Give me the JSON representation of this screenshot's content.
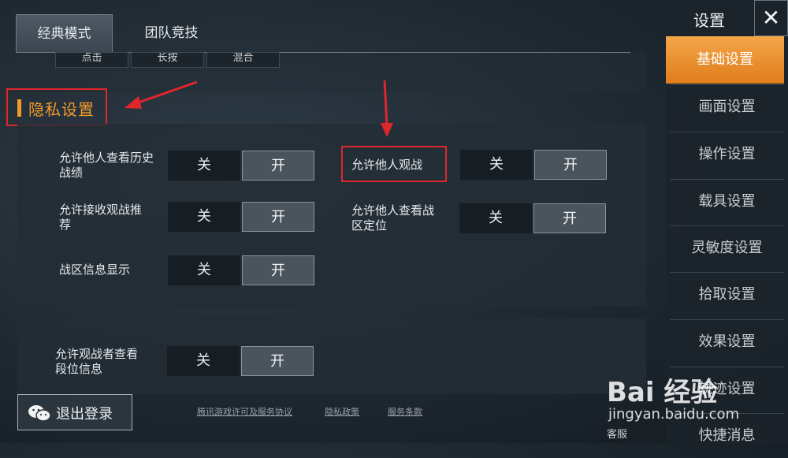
{
  "tabs": [
    {
      "label": "经典模式",
      "active": true
    },
    {
      "label": "团队竞技",
      "active": false
    }
  ],
  "top_segment": [
    "点击",
    "长按",
    "混合"
  ],
  "section_title": "隐私设置",
  "settings": [
    {
      "label": "允许他人查看历史战绩",
      "off": "关",
      "on": "开",
      "value": "开"
    },
    {
      "label": "允许接收观战推荐",
      "off": "关",
      "on": "开",
      "value": "开"
    },
    {
      "label": "战区信息显示",
      "off": "关",
      "on": "开",
      "value": "开"
    },
    {
      "label": "允许他人观战",
      "off": "关",
      "on": "开",
      "value": "开"
    },
    {
      "label": "允许他人查看战区定位",
      "off": "关",
      "on": "开",
      "value": "开"
    },
    {
      "label": "允许观战者查看段位信息",
      "off": "关",
      "on": "开",
      "value": "开"
    }
  ],
  "sidebar": {
    "title": "设置",
    "close": "✕",
    "items": [
      "基础设置",
      "画面设置",
      "操作设置",
      "载具设置",
      "灵敏度设置",
      "拾取设置",
      "效果设置",
      "轨迹设置",
      "快捷消息"
    ],
    "active_index": 0
  },
  "logout": {
    "label": "退出登录"
  },
  "footer": {
    "license": "腾讯游戏许可及服务协议",
    "privacy": "隐私政策",
    "terms": "服务条款",
    "support": "客服"
  },
  "watermark": {
    "brand": "Bai 经验",
    "url": "jingyan.baidu.com"
  },
  "colors": {
    "accent": "#f09a2c",
    "highlight": "#e0262d"
  }
}
